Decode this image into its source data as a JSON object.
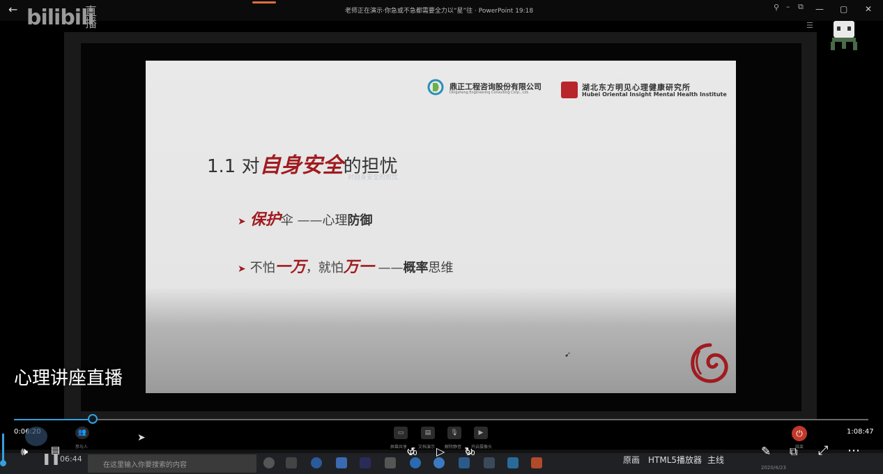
{
  "window": {
    "back_label": "←",
    "logo_text": "bilibili",
    "logo_suffix": "直播",
    "share_banner": "老师正在演示·你急或不急都需要全力以“星”往 · PowerPoint 19:18",
    "minimize": "—",
    "restore": "▢",
    "close": "✕",
    "pin": "⚲",
    "min_small": "–",
    "restore_small": "⧉",
    "menu": "☰"
  },
  "slide": {
    "logo1_name": "鼎正工程咨询股份有限公司",
    "logo1_en": "Dingzheng Engineering Consulting Corp., Ltd.",
    "logo2_cn": "湖北东方明见心理健康研究所",
    "logo2_en": "Hubei Oriental Insight Mental Health Institute",
    "title_prefix": "1.1 对",
    "title_red": "自身安全",
    "title_suffix": "的担忧",
    "ghost_subtitle": "对自身安全的担忧",
    "bullet1_arrow": "➤",
    "bullet1_red": "保护",
    "bullet1_mid": "伞 ——心理",
    "bullet1_bold": "防御",
    "bullet2_arrow": "➤",
    "bullet2_a": "不怕",
    "bullet2_red1": "一万",
    "bullet2_b": "，就怕",
    "bullet2_red2": "万一",
    "bullet2_c": " ——",
    "bullet2_bold": "概率",
    "bullet2_d": "思维"
  },
  "overlay": {
    "stream_title": "心理讲座直播",
    "time_current": "0:06:20",
    "time_total": "1:08:47",
    "elapsed_dim": "06:44",
    "progress_fraction": 0.092
  },
  "meeting": {
    "participants": "参与人",
    "share_screen": "屏幕共享",
    "share_doc": "文档演示",
    "unmute": "解除静音",
    "camera": "开启摄像头",
    "end": "结束"
  },
  "controls": {
    "volume": "🕪",
    "danmaku": "▤",
    "pause": "❚❚",
    "rewind": "↺",
    "rewind_seconds": "10",
    "play": "▷",
    "forward": "↻",
    "forward_seconds": "30",
    "quality": "原画",
    "player": "HTML5播放器",
    "line": "主线",
    "pen": "✎",
    "pip": "⧉",
    "fullscreen": "⤢",
    "more": "⋯"
  },
  "taskbar": {
    "search_placeholder": "在这里输入你要搜索的内容",
    "date": "2020/4/23"
  },
  "colors": {
    "accent_blue": "#35a0dd",
    "slide_red": "#a01b1f",
    "end_red": "#c0392b"
  }
}
